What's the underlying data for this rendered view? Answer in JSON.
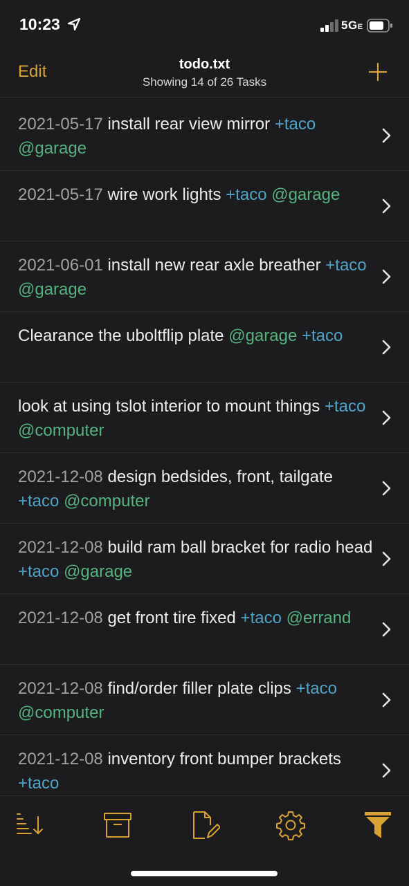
{
  "status": {
    "time": "10:23",
    "network": "5G",
    "network_suffix": "E"
  },
  "nav": {
    "edit_label": "Edit",
    "title": "todo.txt",
    "subtitle": "Showing 14 of 26 Tasks",
    "add_icon": "plus-icon"
  },
  "colors": {
    "accent": "#d9a334",
    "project": "#4fa3c7",
    "context": "#56b27e",
    "date": "#a2a2a4",
    "background": "#1c1c1e"
  },
  "tasks": [
    {
      "date": "2021-05-17",
      "text": "install rear view mirror",
      "tags": [
        {
          "type": "project",
          "text": "+taco"
        },
        {
          "type": "context",
          "text": "@garage"
        }
      ]
    },
    {
      "date": "2021-05-17",
      "text": "wire work lights",
      "tags": [
        {
          "type": "project",
          "text": "+taco"
        },
        {
          "type": "context",
          "text": "@garage"
        }
      ]
    },
    {
      "date": "2021-06-01",
      "text": "install new rear axle breather",
      "tags": [
        {
          "type": "project",
          "text": "+taco"
        },
        {
          "type": "context",
          "text": "@garage"
        }
      ]
    },
    {
      "date": "",
      "text": "Clearance the uboltflip plate",
      "tags": [
        {
          "type": "context",
          "text": "@garage"
        },
        {
          "type": "project",
          "text": "+taco"
        }
      ]
    },
    {
      "date": "",
      "text": "look at using tslot interior to mount things",
      "tags": [
        {
          "type": "project",
          "text": "+taco"
        },
        {
          "type": "context",
          "text": "@computer"
        }
      ]
    },
    {
      "date": "2021-12-08",
      "text": "design bedsides, front, tailgate ",
      "tags": [
        {
          "type": "project",
          "text": "+taco"
        },
        {
          "type": "context",
          "text": "@computer"
        }
      ]
    },
    {
      "date": "2021-12-08",
      "text": "build ram ball bracket for radio head",
      "tags": [
        {
          "type": "project",
          "text": "+taco"
        },
        {
          "type": "context",
          "text": "@garage"
        }
      ]
    },
    {
      "date": "2021-12-08",
      "text": "get front tire fixed",
      "tags": [
        {
          "type": "project",
          "text": "+taco"
        },
        {
          "type": "context",
          "text": "@errand"
        }
      ]
    },
    {
      "date": "2021-12-08",
      "text": "find/order filler plate clips",
      "tags": [
        {
          "type": "project",
          "text": "+taco"
        },
        {
          "type": "context",
          "text": "@computer"
        }
      ]
    },
    {
      "date": "2021-12-08",
      "text": "inventory front bumper brackets",
      "tags": [
        {
          "type": "project",
          "text": "+taco"
        }
      ]
    }
  ],
  "toolbar": {
    "items": [
      {
        "icon": "sort-icon"
      },
      {
        "icon": "archive-icon"
      },
      {
        "icon": "new-document-icon"
      },
      {
        "icon": "settings-gear-icon"
      },
      {
        "icon": "filter-icon"
      }
    ]
  }
}
